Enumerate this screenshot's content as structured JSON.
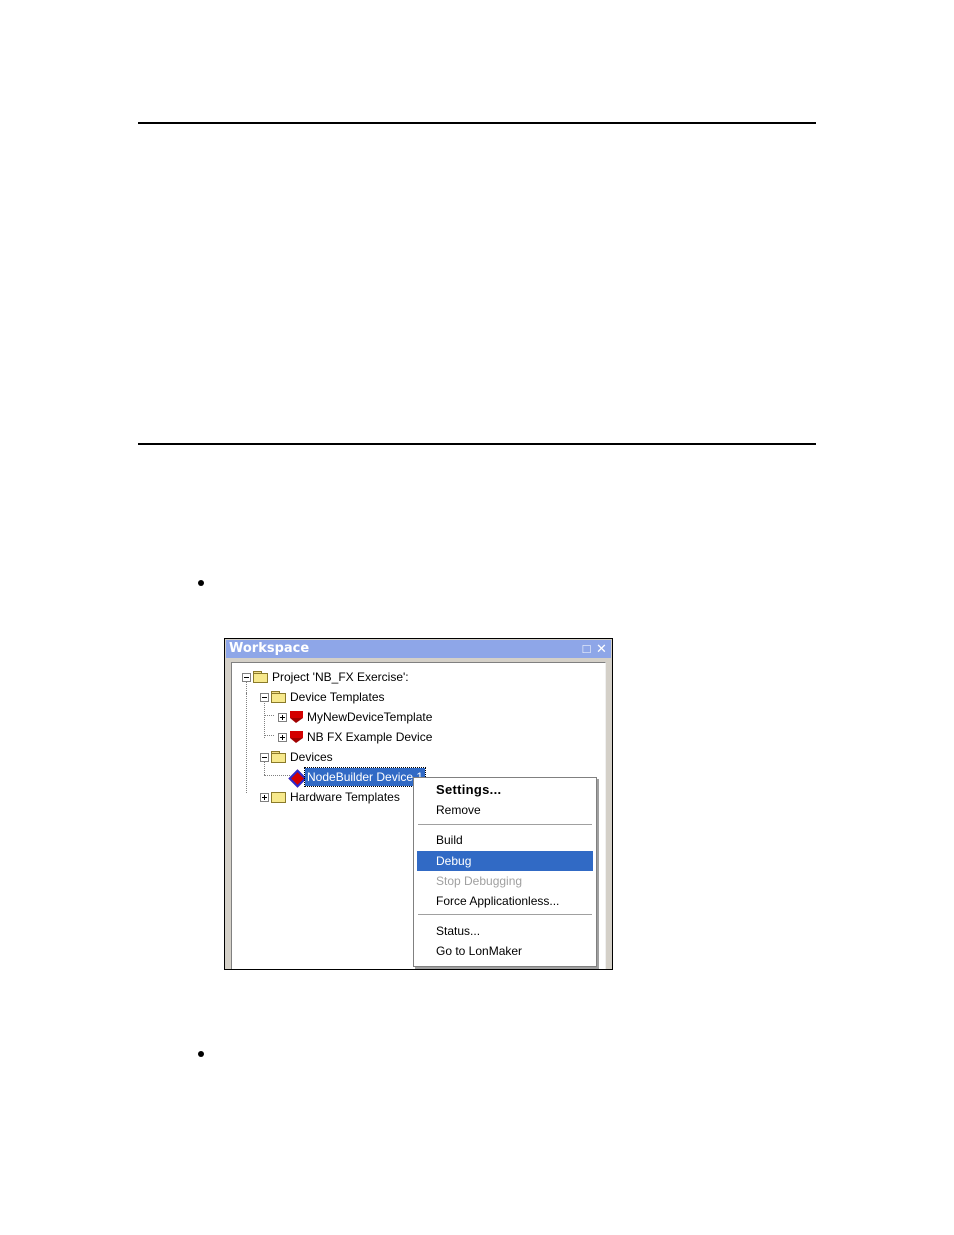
{
  "workspace": {
    "title": "Workspace",
    "tree": {
      "project": "Project 'NB_FX Exercise':",
      "device_templates": "Device Templates",
      "template_1": "MyNewDeviceTemplate",
      "template_2": "NB FX Example Device",
      "devices": "Devices",
      "device_1": "NodeBuilder Device 1",
      "hardware_templates": "Hardware Templates"
    }
  },
  "context_menu": {
    "settings": "Settings...",
    "remove": "Remove",
    "build": "Build",
    "debug": "Debug",
    "stop_debugging": "Stop Debugging",
    "force_applicationless": "Force Applicationless...",
    "status": "Status...",
    "go_to_lonmaker": "Go to LonMaker"
  },
  "colors": {
    "title_bar": "#8ea6e8",
    "selection": "#316ac5"
  }
}
